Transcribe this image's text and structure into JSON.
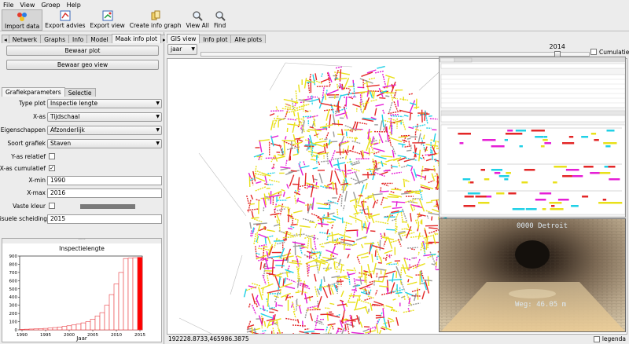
{
  "menu": [
    "File",
    "View",
    "Groep",
    "Help"
  ],
  "toolbar": [
    {
      "label": "Import data",
      "icon": "import-data-icon",
      "active": true
    },
    {
      "label": "Export advies",
      "icon": "export-advies-icon"
    },
    {
      "label": "Export view",
      "icon": "export-view-icon"
    },
    {
      "label": "Create info graph",
      "icon": "info-graph-icon"
    },
    {
      "label": "View All",
      "icon": "magnifier-icon"
    },
    {
      "label": "Find",
      "icon": "magnifier-icon"
    }
  ],
  "left_tabs": [
    "Netwerk",
    "Graphs",
    "Info",
    "Model",
    "Maak info plot"
  ],
  "buttons": {
    "plot": "Bewaar plot",
    "geo": "Bewaar geo view"
  },
  "sub_tabs": [
    "Grafiekparameters",
    "Selectie"
  ],
  "form": {
    "type_plot": {
      "label": "Type plot",
      "value": "Inspectie lengte"
    },
    "x_as": {
      "label": "X-as",
      "value": "Tijdschaal"
    },
    "eigenschappen": {
      "label": "Eigenschappen",
      "value": "Afzonderlijk"
    },
    "soort": {
      "label": "Soort grafiek",
      "value": "Staven"
    },
    "y_rel": {
      "label": "Y-as relatief",
      "checked": false
    },
    "x_cum": {
      "label": "X-as cumulatief",
      "checked": true
    },
    "x_min": {
      "label": "X-min",
      "value": "1990"
    },
    "x_max": {
      "label": "X-max",
      "value": "2016"
    },
    "vaste_kleur": {
      "label": "Vaste kleur",
      "checked": false
    },
    "scheiding": {
      "label": "Visuele scheiding",
      "value": "2015"
    }
  },
  "chart_data": {
    "type": "bar",
    "title": "Inspectielengte",
    "xlabel": "Jaar",
    "ylabel": "",
    "ylim": [
      0,
      900
    ],
    "yticks": [
      0,
      100,
      200,
      300,
      400,
      500,
      600,
      700,
      800,
      900
    ],
    "xticks": [
      1990,
      1995,
      2000,
      2005,
      2010,
      2015
    ],
    "categories": [
      1990,
      1991,
      1992,
      1993,
      1994,
      1995,
      1996,
      1997,
      1998,
      1999,
      2000,
      2001,
      2002,
      2003,
      2004,
      2005,
      2006,
      2007,
      2008,
      2009,
      2010,
      2011,
      2012,
      2013,
      2014,
      2015
    ],
    "values": [
      5,
      8,
      10,
      12,
      15,
      18,
      22,
      28,
      35,
      42,
      50,
      60,
      70,
      85,
      100,
      130,
      170,
      210,
      300,
      430,
      560,
      700,
      870,
      875,
      880,
      885
    ],
    "highlight_from": 2015,
    "colors": {
      "normal": "#e8393f",
      "highlight": "#ff0000"
    }
  },
  "right_tabs": [
    "GIS view",
    "Info plot",
    "Alle plots"
  ],
  "period": {
    "value": "jaar"
  },
  "slider": {
    "min": 1990,
    "max": 2016,
    "value": 2014,
    "label": "2014"
  },
  "cumulatief": {
    "label": "Cumulatief",
    "checked": false
  },
  "status": {
    "coords": "192228.8733,465986.3875"
  },
  "legenda": {
    "label": "legenda",
    "checked": false
  },
  "photo": {
    "top": "0000  Detroit",
    "bottom": "Weg:   46.05 m"
  },
  "colors": {
    "magenta": "#e51fd6",
    "yellow": "#e9e01a",
    "cyan": "#1fd0e6",
    "red": "#e32727",
    "gray": "#9a9a9a"
  }
}
